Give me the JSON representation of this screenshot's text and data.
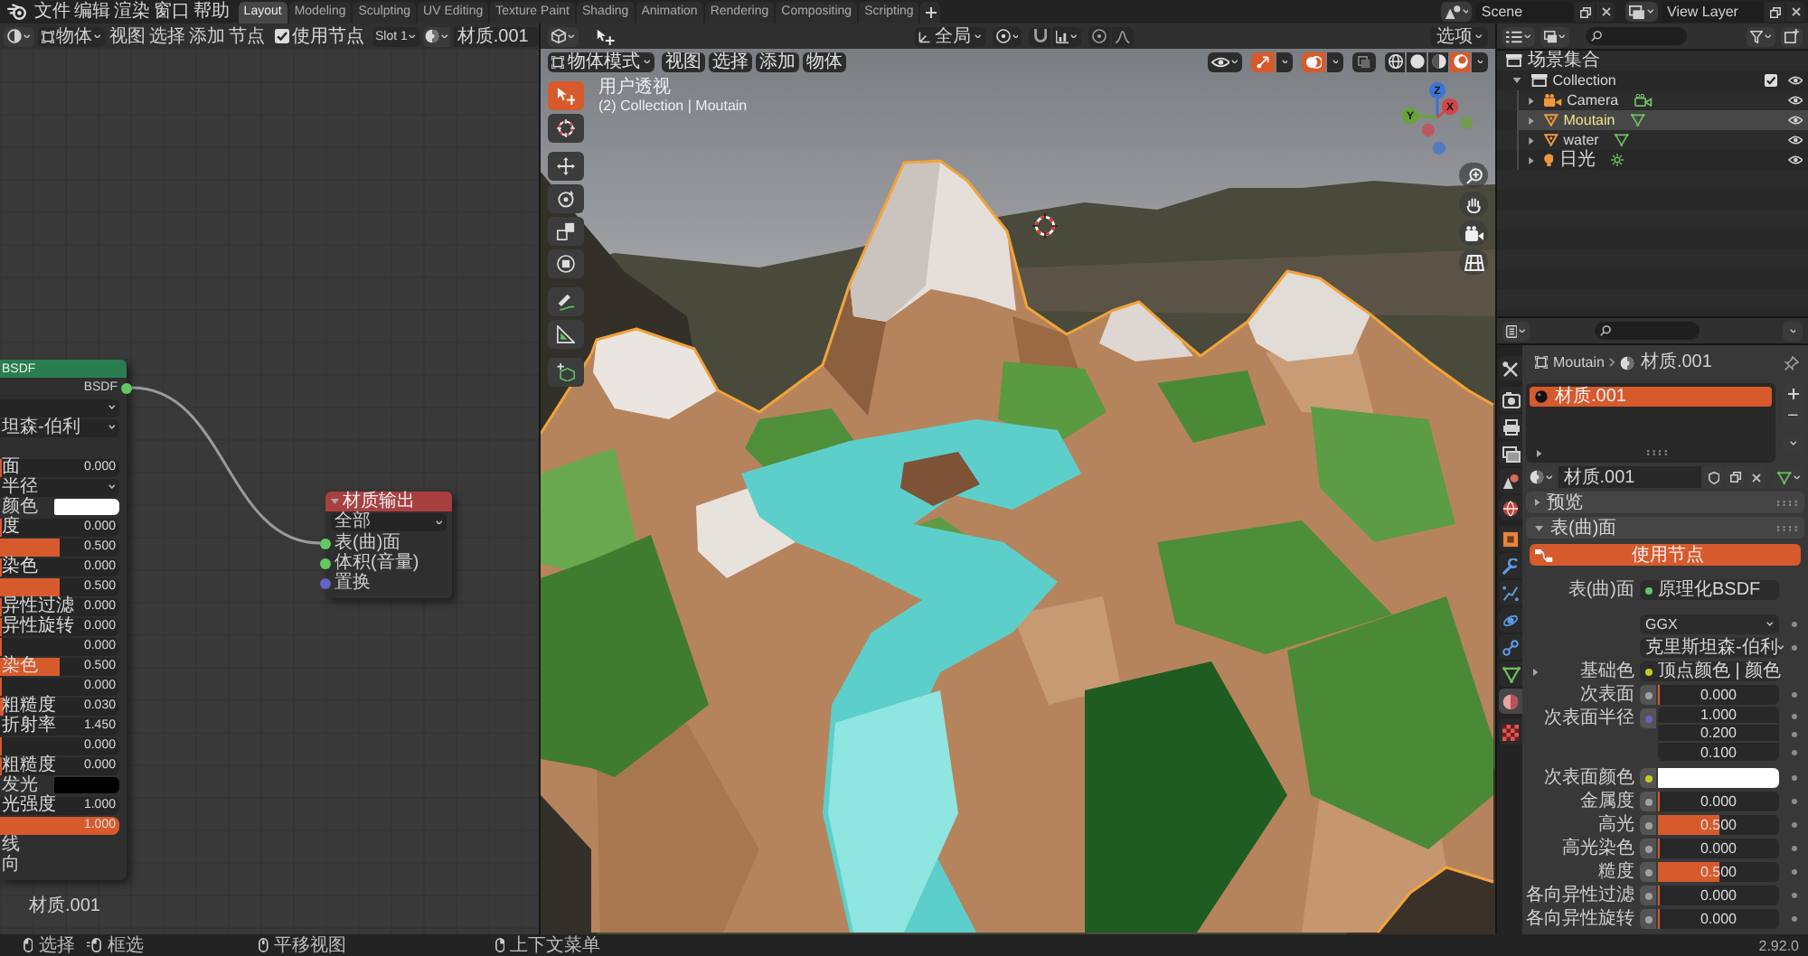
{
  "topbar": {
    "menus": [
      "文件",
      "编辑",
      "渲染",
      "窗口",
      "帮助"
    ],
    "workspaces": [
      {
        "label": "Layout",
        "selected": true
      },
      {
        "label": "Modeling",
        "selected": false
      },
      {
        "label": "Sculpting",
        "selected": false
      },
      {
        "label": "UV Editing",
        "selected": false
      },
      {
        "label": "Texture Paint",
        "selected": false
      },
      {
        "label": "Shading",
        "selected": false
      },
      {
        "label": "Animation",
        "selected": false
      },
      {
        "label": "Rendering",
        "selected": false
      },
      {
        "label": "Compositing",
        "selected": false
      },
      {
        "label": "Scripting",
        "selected": false
      }
    ],
    "scene": "Scene",
    "view_layer": "View Layer"
  },
  "node_editor": {
    "header": {
      "object_type": "物体",
      "menus": [
        "视图",
        "选择",
        "添加",
        "节点"
      ],
      "use_nodes": {
        "label": "使用节点",
        "checked": true
      },
      "slot": "Slot 1",
      "material": "材质.001"
    },
    "nodes": [
      {
        "kind": "bsdf",
        "title": "BSDF",
        "output": "BSDF",
        "rows": [
          {
            "kind": "dropdown"
          },
          {
            "kind": "dropdown",
            "label": "坦森-伯利"
          },
          {
            "kind": "linked"
          },
          {
            "kind": "slider",
            "label": "面",
            "value": "0.000",
            "level": 0
          },
          {
            "kind": "dropdown",
            "label": "半径"
          },
          {
            "kind": "color",
            "label": "颜色",
            "color": "#ffffff"
          },
          {
            "kind": "slider",
            "label": "度",
            "value": "0.000",
            "level": 0
          },
          {
            "kind": "slider",
            "value": "0.500",
            "level": 0.5
          },
          {
            "kind": "slider",
            "label": "染色",
            "value": "0.000",
            "level": 0
          },
          {
            "kind": "slider",
            "value": "0.500",
            "level": 0.5
          },
          {
            "kind": "slider",
            "label": "异性过滤",
            "value": "0.000",
            "level": 0
          },
          {
            "kind": "slider",
            "label": "异性旋转",
            "value": "0.000",
            "level": 0
          },
          {
            "kind": "slider",
            "value": "0.000",
            "level": 0
          },
          {
            "kind": "slider",
            "label": "染色",
            "value": "0.500",
            "level": 0.5
          },
          {
            "kind": "slider",
            "value": "0.000",
            "level": 0
          },
          {
            "kind": "slider",
            "label": "粗糙度",
            "value": "0.030",
            "level": 0.03
          },
          {
            "kind": "number",
            "label": "折射率",
            "value": "1.450"
          },
          {
            "kind": "slider",
            "value": "0.000",
            "level": 0
          },
          {
            "kind": "slider",
            "label": "粗糙度",
            "value": "0.000",
            "level": 0
          },
          {
            "kind": "color",
            "label": "发光",
            "color": "#000000"
          },
          {
            "kind": "number",
            "label": "光强度",
            "value": "1.000"
          },
          {
            "kind": "slider",
            "value": "1.000",
            "level": 1
          },
          {
            "kind": "linked",
            "label": "线"
          },
          {
            "kind": "linked",
            "label": "向"
          }
        ]
      },
      {
        "kind": "output",
        "title": "材质输出",
        "expanded": true,
        "target": "全部",
        "inputs": [
          {
            "label": "表(曲)面",
            "color": "#63c763"
          },
          {
            "label": "体积(音量)",
            "color": "#63c763"
          },
          {
            "label": "置换",
            "color": "#6363c7"
          }
        ]
      }
    ],
    "material_label": "材质.001"
  },
  "viewport": {
    "tool_header": {
      "orientation": "全局",
      "options": "选项"
    },
    "header": {
      "mode": "物体模式",
      "menus": [
        "视图",
        "选择",
        "添加",
        "物体"
      ],
      "toggles": [
        {
          "kind": "gizmo",
          "on": true
        },
        {
          "kind": "overlay",
          "on": true
        },
        {
          "kind": "xray",
          "on": false
        }
      ],
      "shading": [
        {
          "kind": "wireframe",
          "selected": false
        },
        {
          "kind": "solid",
          "selected": false
        },
        {
          "kind": "material",
          "selected": false
        },
        {
          "kind": "rendered",
          "selected": true
        }
      ]
    },
    "view_name": "用户透视",
    "object_info": "(2) Collection | Moutain",
    "tool_groups": [
      [
        {
          "kind": "select_box",
          "selected": true
        },
        {
          "kind": "cursor",
          "selected": false
        }
      ],
      [
        {
          "kind": "move",
          "selected": false
        },
        {
          "kind": "rotate",
          "selected": false
        },
        {
          "kind": "scale",
          "selected": false
        },
        {
          "kind": "transform",
          "selected": false
        }
      ],
      [
        {
          "kind": "annotate",
          "selected": false
        },
        {
          "kind": "measure",
          "selected": false
        }
      ],
      [
        {
          "kind": "add_cube",
          "selected": false
        }
      ]
    ],
    "gizmo": {
      "axes": [
        {
          "label": "Z",
          "color": "#3b74d6"
        },
        {
          "label": "Y",
          "color": "#68a33a"
        },
        {
          "label": "X",
          "color": "#d2434b"
        }
      ]
    }
  },
  "outliner": {
    "root": "场景集合",
    "items": [
      {
        "name": "Collection",
        "kind": "collection",
        "expanded": true,
        "checked": true,
        "children": [
          {
            "name": "Camera",
            "kind": "camera",
            "expanded": false,
            "selected": false
          },
          {
            "name": "Moutain",
            "kind": "mesh",
            "expanded": false,
            "selected": true
          },
          {
            "name": "water",
            "kind": "mesh",
            "expanded": false,
            "selected": false
          },
          {
            "name": "日光",
            "kind": "light",
            "expanded": false,
            "selected": false
          }
        ]
      }
    ]
  },
  "properties": {
    "tab_groups": [
      [
        {
          "kind": "tool",
          "selected": false
        }
      ],
      [
        {
          "kind": "render",
          "selected": false
        },
        {
          "kind": "output",
          "selected": false
        },
        {
          "kind": "view_layer",
          "selected": false
        },
        {
          "kind": "scene",
          "selected": false
        },
        {
          "kind": "world",
          "selected": false
        }
      ],
      [
        {
          "kind": "object",
          "selected": false
        },
        {
          "kind": "modifiers",
          "selected": false
        },
        {
          "kind": "particles",
          "selected": false
        },
        {
          "kind": "physics",
          "selected": false
        },
        {
          "kind": "constraints",
          "selected": false
        },
        {
          "kind": "data",
          "selected": false
        },
        {
          "kind": "material",
          "selected": true
        }
      ],
      [
        {
          "kind": "texture",
          "selected": false
        }
      ]
    ],
    "breadcrumb": {
      "object": "Moutain",
      "material": "材质.001"
    },
    "slots": [
      {
        "name": "材质.001",
        "selected": true
      }
    ],
    "material": "材质.001",
    "panels": [
      {
        "title": "预览",
        "expanded": false
      },
      {
        "title": "表(曲)面",
        "expanded": true,
        "use_nodes": "使用节点",
        "rows": [
          {
            "kind": "link",
            "label": "表(曲)面",
            "value": "原理化BSDF",
            "color": "#63c763"
          },
          {
            "kind": "dropdown",
            "value": "GGX"
          },
          {
            "kind": "dropdown",
            "value": "克里斯坦森-伯利"
          },
          {
            "kind": "link",
            "label": "基础色",
            "value": "顶点颜色 | 颜色",
            "color": "#c7c729",
            "expanded": false
          },
          {
            "kind": "slider",
            "label": "次表面",
            "value": "0.000",
            "level": 0,
            "color": "#a1a1a1"
          },
          {
            "kind": "vector",
            "label": "次表面半径",
            "values": [
              "1.000",
              "0.200",
              "0.100"
            ],
            "color": "#6363c7"
          },
          {
            "kind": "color",
            "label": "次表面颜色",
            "color": "#c7c729",
            "swatch": {
              "color": "#ffffff"
            }
          },
          {
            "kind": "slider",
            "label": "金属度",
            "value": "0.000",
            "level": 0,
            "color": "#a1a1a1"
          },
          {
            "kind": "slider",
            "label": "高光",
            "value": "0.500",
            "level": 0.5,
            "color": "#a1a1a1"
          },
          {
            "kind": "slider",
            "label": "高光染色",
            "value": "0.000",
            "level": 0,
            "color": "#a1a1a1"
          },
          {
            "kind": "slider",
            "label": "糙度",
            "value": "0.500",
            "level": 0.5,
            "color": "#a1a1a1"
          },
          {
            "kind": "slider",
            "label": "各向异性过滤",
            "value": "0.000",
            "level": 0,
            "color": "#a1a1a1"
          },
          {
            "kind": "slider",
            "label": "各向异性旋转",
            "value": "0.000",
            "level": 0,
            "color": "#a1a1a1"
          }
        ]
      }
    ]
  },
  "status_bar": {
    "hints": [
      {
        "kind": "left_click",
        "label": "选择"
      },
      {
        "kind": "left_drag",
        "label": "框选"
      },
      {
        "kind": "middle_drag",
        "label": "平移视图"
      },
      {
        "kind": "right_click",
        "label": "上下文菜单"
      }
    ],
    "version": "2.92.0"
  }
}
